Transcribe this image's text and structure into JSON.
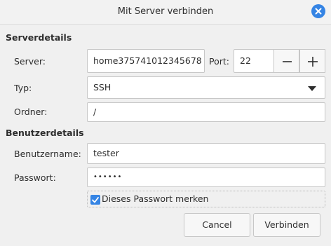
{
  "window": {
    "title": "Mit Server verbinden"
  },
  "server_section": {
    "heading": "Serverdetails",
    "server_label": "Server:",
    "server_value": "home375741012345678",
    "port_label": "Port:",
    "port_value": "22",
    "type_label": "Typ:",
    "type_value": "SSH",
    "folder_label": "Ordner:",
    "folder_value": "/"
  },
  "user_section": {
    "heading": "Benutzerdetails",
    "username_label": "Benutzername:",
    "username_value": "tester",
    "password_label": "Passwort:",
    "password_value": "••••••",
    "remember_label": "Dieses Passwort merken",
    "remember_checked": true
  },
  "buttons": {
    "cancel": "Cancel",
    "connect": "Verbinden"
  },
  "icons": {
    "close": "close-icon",
    "minus": "minus-icon",
    "plus": "plus-icon",
    "dropdown": "chevron-down-icon",
    "checkmark": "checkmark-icon"
  },
  "colors": {
    "accent": "#3584e4",
    "background": "#f0f0f0",
    "field_border": "#c7c7c7"
  }
}
